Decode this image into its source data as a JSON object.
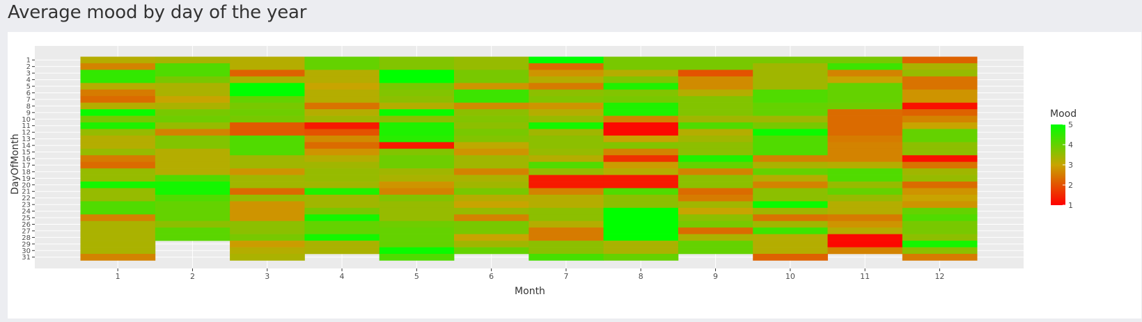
{
  "page": {
    "title": "Average mood by day of the year"
  },
  "chart_data": {
    "type": "heatmap",
    "xlabel": "Month",
    "ylabel": "DayOfMonth",
    "x_categories": [
      "1",
      "2",
      "3",
      "4",
      "5",
      "6",
      "7",
      "8",
      "9",
      "10",
      "11",
      "12"
    ],
    "y_categories": [
      "1",
      "2",
      "3",
      "4",
      "5",
      "6",
      "7",
      "8",
      "9",
      "10",
      "11",
      "12",
      "13",
      "14",
      "15",
      "16",
      "17",
      "18",
      "19",
      "20",
      "21",
      "22",
      "23",
      "24",
      "25",
      "26",
      "27",
      "28",
      "29",
      "30",
      "31"
    ],
    "legend": {
      "title": "Mood",
      "ticks": [
        "1",
        "2",
        "3",
        "4",
        "5"
      ],
      "min": 1,
      "max": 5,
      "position": "right"
    },
    "colors": {
      "low": "#ff0000",
      "mid": "#c8a400",
      "high": "#00ff00",
      "plot_bg": "#ebebeb",
      "grid": "#ffffff"
    },
    "grid": true,
    "values": [
      [
        3.2,
        3.3,
        3.2,
        4.0,
        3.7,
        3.5,
        5.0,
        3.8,
        3.8,
        3.8,
        3.8,
        2.2
      ],
      [
        2.6,
        4.2,
        3.2,
        4.0,
        3.7,
        3.5,
        2.3,
        3.8,
        3.8,
        3.4,
        4.4,
        3.3
      ],
      [
        4.5,
        4.2,
        2.2,
        3.2,
        5.0,
        3.8,
        2.8,
        3.2,
        2.0,
        3.4,
        2.6,
        3.5
      ],
      [
        4.5,
        3.8,
        3.3,
        3.2,
        5.0,
        3.8,
        3.2,
        3.7,
        2.7,
        3.4,
        3.0,
        2.4
      ],
      [
        3.2,
        3.3,
        5.0,
        3.0,
        3.8,
        2.8,
        2.5,
        4.7,
        2.7,
        3.4,
        4.0,
        2.4
      ],
      [
        2.5,
        3.3,
        5.0,
        3.2,
        3.7,
        4.4,
        3.6,
        3.7,
        3.2,
        4.2,
        4.0,
        2.8
      ],
      [
        2.3,
        3.0,
        4.0,
        3.2,
        3.6,
        4.4,
        3.7,
        3.8,
        3.7,
        4.2,
        4.0,
        2.8
      ],
      [
        3.2,
        3.3,
        3.8,
        2.4,
        3.2,
        2.7,
        2.8,
        4.7,
        3.7,
        4.0,
        3.9,
        1.2
      ],
      [
        4.9,
        3.8,
        3.9,
        3.2,
        4.9,
        3.6,
        3.2,
        4.7,
        3.7,
        4.0,
        2.3,
        2.2
      ],
      [
        3.8,
        3.9,
        3.8,
        3.4,
        3.6,
        3.7,
        3.5,
        2.6,
        3.4,
        3.4,
        2.3,
        2.6
      ],
      [
        4.7,
        3.5,
        2.1,
        1.3,
        4.7,
        3.6,
        4.8,
        1.1,
        4.2,
        3.8,
        2.3,
        3.0
      ],
      [
        3.5,
        2.6,
        2.1,
        2.0,
        4.7,
        3.8,
        3.4,
        1.1,
        3.2,
        4.9,
        2.3,
        4.0
      ],
      [
        3.2,
        3.7,
        4.2,
        2.7,
        4.6,
        3.7,
        3.6,
        3.0,
        3.4,
        4.2,
        2.5,
        4.0
      ],
      [
        3.2,
        3.7,
        4.2,
        2.3,
        1.3,
        3.1,
        3.6,
        3.7,
        3.6,
        4.2,
        2.6,
        3.6
      ],
      [
        3.5,
        3.2,
        4.2,
        2.8,
        3.7,
        2.8,
        3.5,
        2.6,
        3.6,
        4.2,
        2.6,
        3.6
      ],
      [
        2.5,
        3.2,
        3.4,
        3.2,
        3.9,
        3.4,
        3.2,
        1.6,
        4.7,
        2.6,
        2.6,
        1.2
      ],
      [
        2.3,
        3.2,
        3.4,
        3.4,
        3.9,
        3.4,
        4.2,
        2.9,
        4.0,
        3.3,
        3.2,
        2.4
      ],
      [
        3.5,
        3.2,
        2.8,
        3.5,
        3.4,
        2.6,
        3.5,
        3.2,
        2.6,
        4.0,
        4.2,
        3.4
      ],
      [
        3.5,
        4.2,
        3.4,
        3.5,
        3.3,
        3.3,
        1.3,
        1.3,
        3.6,
        3.2,
        4.2,
        3.5
      ],
      [
        4.8,
        4.8,
        3.4,
        3.4,
        2.8,
        3.4,
        1.3,
        1.3,
        3.6,
        2.6,
        3.5,
        2.3
      ],
      [
        3.5,
        4.8,
        2.3,
        4.7,
        2.6,
        3.8,
        2.6,
        4.2,
        2.3,
        3.6,
        4.0,
        2.8
      ],
      [
        3.5,
        4.2,
        3.5,
        3.4,
        3.7,
        3.2,
        3.2,
        3.6,
        2.5,
        3.6,
        3.5,
        3.0
      ],
      [
        4.2,
        4.0,
        2.8,
        3.4,
        3.5,
        3.0,
        3.2,
        3.6,
        3.4,
        4.9,
        3.2,
        2.8
      ],
      [
        4.2,
        4.0,
        2.8,
        3.8,
        3.5,
        3.5,
        3.6,
        5.0,
        3.0,
        3.4,
        3.2,
        4.0
      ],
      [
        2.6,
        4.0,
        2.8,
        4.8,
        3.5,
        2.6,
        3.6,
        5.0,
        3.6,
        2.4,
        2.5,
        4.2
      ],
      [
        3.3,
        3.6,
        3.6,
        4.0,
        3.9,
        3.8,
        3.2,
        5.0,
        3.8,
        3.4,
        2.8,
        3.8
      ],
      [
        3.3,
        4.1,
        3.6,
        4.0,
        4.0,
        3.8,
        2.5,
        5.0,
        2.3,
        4.4,
        3.2,
        3.8
      ],
      [
        3.3,
        4.1,
        3.8,
        4.8,
        4.0,
        3.0,
        2.5,
        5.0,
        3.3,
        3.2,
        1.1,
        3.6
      ],
      [
        3.3,
        null,
        2.9,
        3.3,
        4.0,
        3.4,
        3.6,
        3.3,
        4.0,
        3.2,
        1.1,
        4.8
      ],
      [
        3.3,
        null,
        3.2,
        3.3,
        4.9,
        4.0,
        3.6,
        3.3,
        4.0,
        3.2,
        2.6,
        3.6
      ],
      [
        2.6,
        null,
        3.3,
        null,
        4.2,
        null,
        4.3,
        4.0,
        null,
        2.2,
        null,
        2.5
      ]
    ]
  }
}
